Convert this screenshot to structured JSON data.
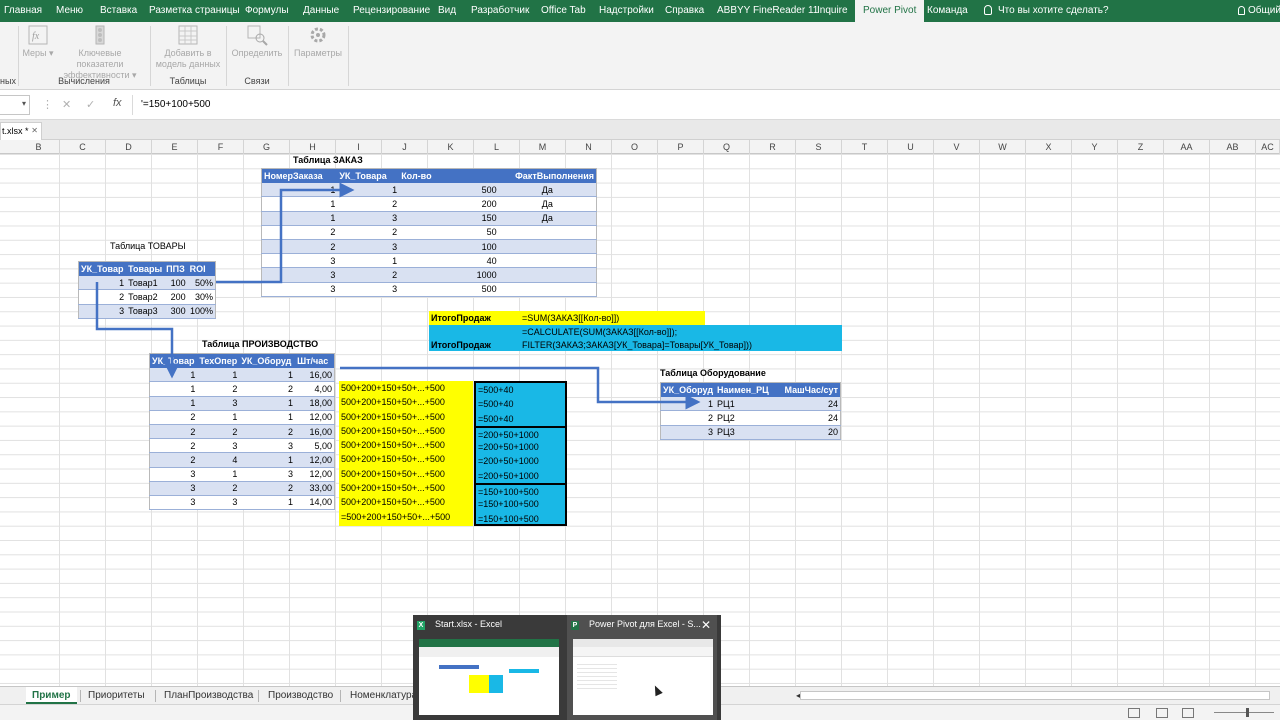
{
  "ribbon": {
    "tabs": [
      "Главная",
      "Меню",
      "Вставка",
      "Разметка страницы",
      "Формулы",
      "Данные",
      "Рецензирование",
      "Вид",
      "Разработчик",
      "Office Tab",
      "Надстройки",
      "Справка",
      "ABBYY FineReader 11",
      "Inquire",
      "Power Pivot",
      "Команда"
    ],
    "active_tab": "Power Pivot",
    "tell_me": "Что вы хотите сделать?",
    "account": "Общий",
    "buttons": {
      "measures": "Меры",
      "kpi_line1": "Ключевые показатели",
      "kpi_line2": "эффективности",
      "add_line1": "Добавить в",
      "add_line2": "модель данных",
      "detect": "Определить",
      "settings": "Параметры"
    },
    "groups": {
      "left_cut": "ных",
      "calculations": "Вычисления",
      "tables": "Таблицы",
      "relations": "Связи"
    }
  },
  "formula_bar": {
    "fx": "fx",
    "value": "'=150+100+500"
  },
  "document_tab": "t.xlsx *",
  "columns": [
    "B",
    "C",
    "D",
    "E",
    "F",
    "G",
    "H",
    "I",
    "J",
    "K",
    "L",
    "M",
    "N",
    "O",
    "P",
    "Q",
    "R",
    "S",
    "T",
    "U",
    "V",
    "W",
    "X",
    "Y",
    "Z",
    "AA",
    "AB",
    "AC"
  ],
  "table_zakaz": {
    "title": "Таблица ЗАКАЗ",
    "headers": [
      "НомерЗаказа",
      "УК_Товара",
      "Кол-во",
      "",
      "ФактВыполнения"
    ],
    "rows": [
      [
        "1",
        "1",
        "",
        "500",
        "Да"
      ],
      [
        "1",
        "2",
        "",
        "200",
        "Да"
      ],
      [
        "1",
        "3",
        "",
        "150",
        "Да"
      ],
      [
        "2",
        "2",
        "",
        "50",
        ""
      ],
      [
        "2",
        "3",
        "",
        "100",
        ""
      ],
      [
        "3",
        "1",
        "",
        "40",
        ""
      ],
      [
        "3",
        "2",
        "",
        "1000",
        ""
      ],
      [
        "3",
        "3",
        "",
        "500",
        ""
      ]
    ]
  },
  "table_tovary": {
    "title": "Таблица ТОВАРЫ",
    "headers": [
      "УК_Товар",
      "Товары",
      "ППЗ",
      "ROI"
    ],
    "rows": [
      [
        "1",
        "Товар1",
        "100",
        "50%"
      ],
      [
        "2",
        "Товар2",
        "200",
        "30%"
      ],
      [
        "3",
        "Товар3",
        "300",
        "100%"
      ]
    ]
  },
  "table_proizvodstvo": {
    "title": "Таблица ПРОИЗВОДСТВО",
    "headers": [
      "УК_Товар",
      "ТехОпер",
      "УК_Оборуд",
      "Шт/час"
    ],
    "rows": [
      [
        "1",
        "1",
        "1",
        "16,00"
      ],
      [
        "1",
        "2",
        "2",
        "4,00"
      ],
      [
        "1",
        "3",
        "1",
        "18,00"
      ],
      [
        "2",
        "1",
        "1",
        "12,00"
      ],
      [
        "2",
        "2",
        "2",
        "16,00"
      ],
      [
        "2",
        "3",
        "3",
        "5,00"
      ],
      [
        "2",
        "4",
        "1",
        "12,00"
      ],
      [
        "3",
        "1",
        "3",
        "12,00"
      ],
      [
        "3",
        "2",
        "2",
        "33,00"
      ],
      [
        "3",
        "3",
        "1",
        "14,00"
      ]
    ]
  },
  "table_oborudovanie": {
    "title": "Таблица Оборудование",
    "headers": [
      "УК_Оборуд",
      "Наимен_РЦ",
      "МашЧас/сут"
    ],
    "rows": [
      [
        "1",
        "РЦ1",
        "24"
      ],
      [
        "2",
        "РЦ2",
        "24"
      ],
      [
        "3",
        "РЦ3",
        "20"
      ]
    ]
  },
  "itogo": {
    "label1": "ИтогоПродаж",
    "formula1": "=SUM(ЗАКАЗ[[Кол-во]])",
    "formula2a": "=CALCULATE(SUM(ЗАКАЗ[[Кол-во]]);",
    "label2": "ИтогоПродаж",
    "formula2b": "FILTER(ЗАКАЗ;ЗАКАЗ[УК_Товара]=Товары[УК_Товар]))"
  },
  "yellow_col": [
    "500+200+150+50+...+500",
    "500+200+150+50+...+500",
    "500+200+150+50+...+500",
    "500+200+150+50+...+500",
    "500+200+150+50+...+500",
    "500+200+150+50+...+500",
    "500+200+150+50+...+500",
    "500+200+150+50+...+500",
    "500+200+150+50+...+500",
    "=500+200+150+50+...+500"
  ],
  "cyan_col": [
    "=500+40",
    "=500+40",
    "=500+40",
    "=200+50+1000",
    "=200+50+1000",
    "=200+50+1000",
    "=200+50+1000",
    "=150+100+500",
    "=150+100+500",
    "=150+100+500"
  ],
  "sheet_tabs": [
    "Пример",
    "Приоритеты",
    "ПланПроизводства",
    "Производство",
    "Номенклатура"
  ],
  "active_sheet": "Пример",
  "previews": [
    {
      "title": "Start.xlsx - Excel"
    },
    {
      "title": "Power Pivot для Excel - S..."
    }
  ],
  "colors": {
    "excel_green": "#217346",
    "table_header": "#4472c4",
    "table_band": "#d9e1f2",
    "yellow": "#ffff00",
    "cyan": "#19b8e6",
    "arrow": "#4472c4"
  }
}
